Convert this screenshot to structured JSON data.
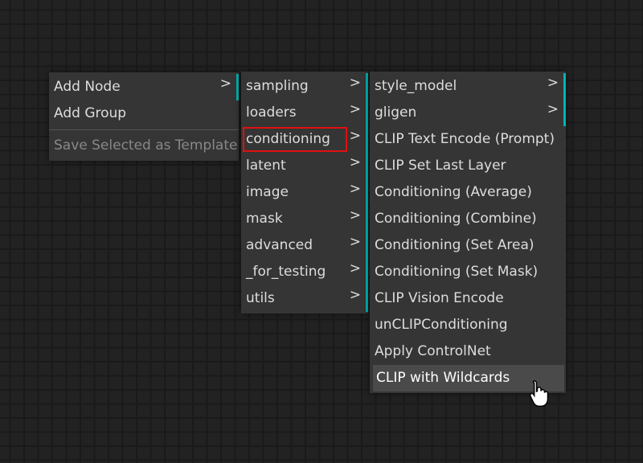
{
  "context_menu": {
    "items": [
      {
        "label": "Add Node",
        "arrow": ">"
      },
      {
        "label": "Add Group"
      },
      {
        "label": "Save Selected as Template"
      }
    ]
  },
  "add_node_menu": {
    "items": [
      {
        "label": "sampling",
        "arrow": ">"
      },
      {
        "label": "loaders",
        "arrow": ">"
      },
      {
        "label": "conditioning",
        "arrow": ">"
      },
      {
        "label": "latent",
        "arrow": ">"
      },
      {
        "label": "image",
        "arrow": ">"
      },
      {
        "label": "mask",
        "arrow": ">"
      },
      {
        "label": "advanced",
        "arrow": ">"
      },
      {
        "label": "_for_testing",
        "arrow": ">"
      },
      {
        "label": "utils",
        "arrow": ">"
      }
    ],
    "highlighted": "conditioning"
  },
  "conditioning_menu": {
    "items": [
      {
        "label": "style_model",
        "arrow": ">"
      },
      {
        "label": "gligen",
        "arrow": ">"
      },
      {
        "label": "CLIP Text Encode (Prompt)"
      },
      {
        "label": "CLIP Set Last Layer"
      },
      {
        "label": "Conditioning (Average)"
      },
      {
        "label": "Conditioning (Combine)"
      },
      {
        "label": "Conditioning (Set Area)"
      },
      {
        "label": "Conditioning (Set Mask)"
      },
      {
        "label": "CLIP Vision Encode"
      },
      {
        "label": "unCLIPConditioning"
      },
      {
        "label": "Apply ControlNet"
      },
      {
        "label": "CLIP with Wildcards"
      }
    ],
    "hovered": "CLIP with Wildcards"
  },
  "colors": {
    "submenu_accent": "#00b3b3",
    "highlight_box": "#e01010",
    "menu_bg": "#353535"
  },
  "icons": {
    "cursor": "hand-pointer-icon"
  }
}
